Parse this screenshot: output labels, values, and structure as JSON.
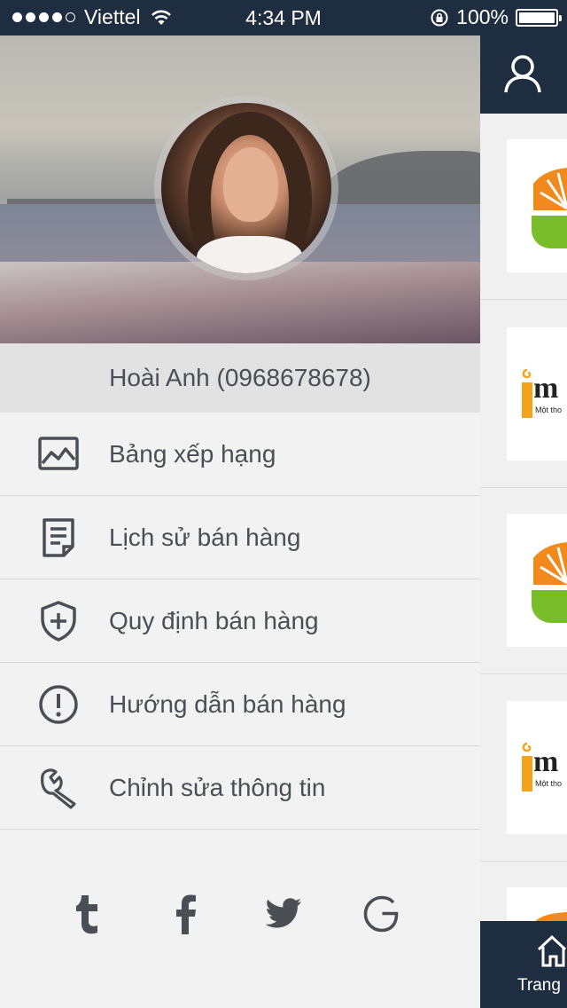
{
  "status_bar": {
    "carrier": "Viettel",
    "time": "4:34 PM",
    "battery": "100%",
    "signal_bars_filled": 4,
    "signal_bars_total": 5
  },
  "drawer": {
    "user_name": "Hoài Anh (0968678678)",
    "menu": [
      {
        "label": "Bảng xếp hạng",
        "icon": "image-icon"
      },
      {
        "label": "Lịch sử bán hàng",
        "icon": "document-icon"
      },
      {
        "label": "Quy định bán hàng",
        "icon": "shield-plus-icon"
      },
      {
        "label": "Hướng dẫn bán hàng",
        "icon": "exclamation-icon"
      },
      {
        "label": "Chỉnh sửa thông tin",
        "icon": "wrench-icon"
      }
    ],
    "social": [
      "tumblr-icon",
      "facebook-icon",
      "twitter-icon",
      "google-icon"
    ]
  },
  "right_panel": {
    "header_icon": "user-icon",
    "cards": [
      {
        "logo": "sun-leaf-logo"
      },
      {
        "logo": "imm-logo",
        "text": "m",
        "subtext": "Một tho"
      },
      {
        "logo": "sun-leaf-logo"
      },
      {
        "logo": "imm-logo",
        "text": "m",
        "subtext": "Một tho"
      },
      {
        "logo": "sun-leaf-logo"
      }
    ],
    "tab_label": "Trang",
    "tab_icon": "home-icon"
  },
  "colors": {
    "navy": "#1f2d40",
    "drawer_bg": "#f2f2f2",
    "text": "#4a4e55",
    "logo_orange": "#f08a1c",
    "logo_green": "#79bd2a"
  }
}
